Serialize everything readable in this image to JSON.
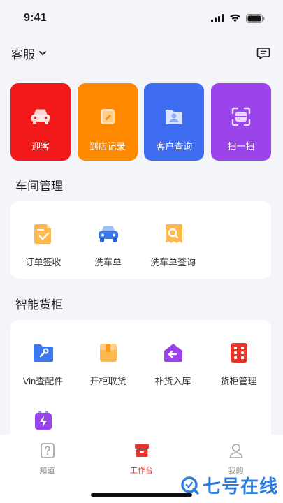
{
  "status_bar": {
    "time": "9:41"
  },
  "header": {
    "title": "客服"
  },
  "quick_actions": [
    {
      "label": "迎客",
      "color": "#f2191b",
      "icon": "car-icon"
    },
    {
      "label": "到店记录",
      "color": "#ff8a00",
      "icon": "record-icon"
    },
    {
      "label": "客户查询",
      "color": "#3f6df2",
      "icon": "customer-folder-icon"
    },
    {
      "label": "扫一扫",
      "color": "#9b44ec",
      "icon": "scan-icon"
    }
  ],
  "workshop": {
    "title": "车间管理",
    "items": [
      {
        "label": "订单签收",
        "icon": "order-sign-icon"
      },
      {
        "label": "洗车单",
        "icon": "car-wash-icon"
      },
      {
        "label": "洗车单查询",
        "icon": "car-wash-search-icon"
      }
    ]
  },
  "smart_cabinet": {
    "title": "智能货柜",
    "items": [
      {
        "label": "Vin查配件",
        "icon": "wrench-folder-icon"
      },
      {
        "label": "开柜取货",
        "icon": "box-icon"
      },
      {
        "label": "补货入库",
        "icon": "restock-house-icon"
      },
      {
        "label": "货柜管理",
        "icon": "cabinet-grid-icon"
      }
    ]
  },
  "tabbar": {
    "tabs": [
      {
        "label": "知道",
        "icon": "question-icon",
        "active": false
      },
      {
        "label": "工作台",
        "icon": "workbench-icon",
        "active": true
      },
      {
        "label": "我的",
        "icon": "profile-icon",
        "active": false
      }
    ]
  },
  "watermark": {
    "text": "七号在线"
  }
}
